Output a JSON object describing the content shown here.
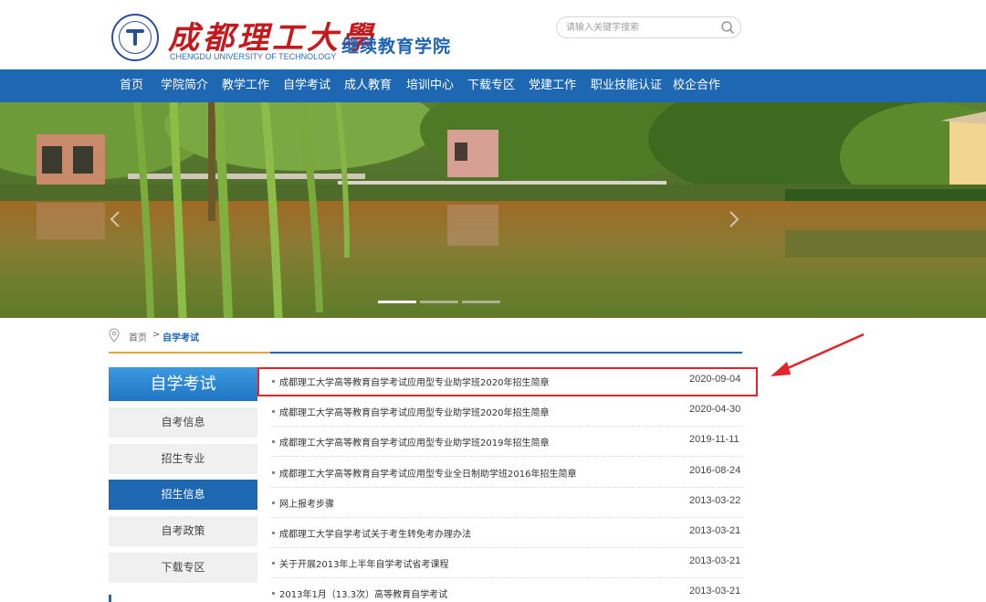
{
  "header": {
    "logo_cn": "成都理工大學",
    "logo_en": "CHENGDU UNIVERSITY OF TECHNOLOGY",
    "college": "继续教育学院",
    "search_placeholder": "请输入关键字搜索",
    "search_icon": "search-icon"
  },
  "nav": {
    "items": [
      "首页",
      "学院简介",
      "教学工作",
      "自学考试",
      "成人教育",
      "培训中心",
      "下载专区",
      "党建工作",
      "职业技能认证",
      "校企合作"
    ]
  },
  "breadcrumb": {
    "home": "首页",
    "sep": ">",
    "current": "自学考试"
  },
  "sidebar": {
    "title": "自学考试",
    "items": [
      {
        "label": "自考信息",
        "active": false
      },
      {
        "label": "招生专业",
        "active": false
      },
      {
        "label": "招生信息",
        "active": true
      },
      {
        "label": "自考政策",
        "active": false
      },
      {
        "label": "下载专区",
        "active": false
      }
    ]
  },
  "list": {
    "rows": [
      {
        "title": "成都理工大学高等教育自学考试应用型专业助学班2020年招生简章",
        "date": "2020-09-04"
      },
      {
        "title": "成都理工大学高等教育自学考试应用型专业助学班2020年招生简章",
        "date": "2020-04-30"
      },
      {
        "title": "成都理工大学高等教育自学考试应用型专业助学班2019年招生简章",
        "date": "2019-11-11"
      },
      {
        "title": "成都理工大学高等教育自学考试应用型专业全日制助学班2016年招生简章",
        "date": "2016-08-24"
      },
      {
        "title": "网上报考步骤",
        "date": "2013-03-22"
      },
      {
        "title": "成都理工大学自学考试关于考生转免考办理办法",
        "date": "2013-03-21"
      },
      {
        "title": "关于开展2013年上半年自学考试省考课程",
        "date": "2013-03-21"
      },
      {
        "title": "2013年1月（13.3次）高等教育自学考试",
        "date": "2013-03-21"
      }
    ]
  },
  "colors": {
    "brand_blue": "#1e67b2",
    "logo_red": "#c41a1e",
    "annotation_red": "#e3242b",
    "accent_orange": "#e8a33b"
  }
}
